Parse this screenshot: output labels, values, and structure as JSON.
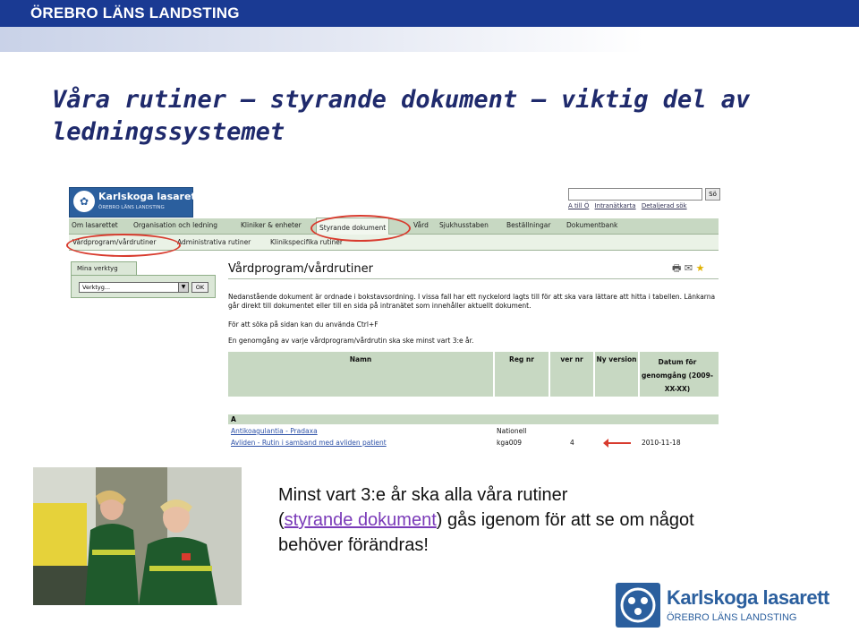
{
  "slide": {
    "brand_top": "ÖREBRO LÄNS LANDSTING",
    "title": "Våra rutiner – styrande dokument – viktig del av ledningssystemet",
    "caption_line1": "Minst vart 3:e år ska alla våra rutiner",
    "caption_open": "(",
    "caption_link": "styrande dokument",
    "caption_rest": ") gås igenom för att se om något",
    "caption_line3": "behöver förändras!",
    "footer_logo_name": "Karlskoga lasarett",
    "footer_logo_sub": "ÖREBRO LÄNS LANDSTING"
  },
  "site": {
    "logo_name": "Karlskoga lasarett",
    "logo_sub": "ÖREBRO LÄNS LANDSTING",
    "search_button": "Sö",
    "top_links": [
      "A till Ö",
      "Intranätkarta",
      "Detaljerad sök"
    ],
    "nav1": [
      "Om lasarettet",
      "Organisation och ledning",
      "Kliniker & enheter",
      "Styrande dokument",
      "Vård",
      "Sjukhusstaben",
      "Beställningar",
      "Dokumentbank"
    ],
    "nav2": [
      "Vårdprogram/vårdrutiner",
      "Administrativa rutiner",
      "Klinikspecifika rutiner"
    ],
    "tools_tab": "Mina verktyg",
    "tools_select": "Verktyg...",
    "tools_ok": "OK",
    "heading": "Vårdprogram/vårdrutiner",
    "intro1": "Nedanstående dokument är ordnade i bokstavsordning. I vissa fall har ett nyckelord lagts till för att ska vara lättare att hitta i tabellen. Länkarna går direkt till dokumentet eller till en sida på intranätet som innehåller aktuellt dokument.",
    "intro2": "För att söka på sidan kan du använda Ctrl+F",
    "intro3": "En genomgång av varje vårdprogram/vårdrutin ska ske minst vart 3:e år.",
    "table_headers": [
      "Namn",
      "Reg nr",
      "ver nr",
      "Ny version",
      "Datum för genomgång (2009-XX-XX)"
    ],
    "section_letter": "A",
    "rows": [
      {
        "name": "Antikoagulantia - Pradaxa",
        "reg": "Nationell",
        "ver": "",
        "date": ""
      },
      {
        "name": "Avliden - Rutin i samband med avliden patient",
        "reg": "kga009",
        "ver": "4",
        "date": "2010-11-18"
      }
    ]
  },
  "colors": {
    "brand_blue": "#1a3a93",
    "nav_green": "#c7d8c2",
    "highlight_red": "#d83b2e",
    "link_purple": "#7a3ab8"
  }
}
